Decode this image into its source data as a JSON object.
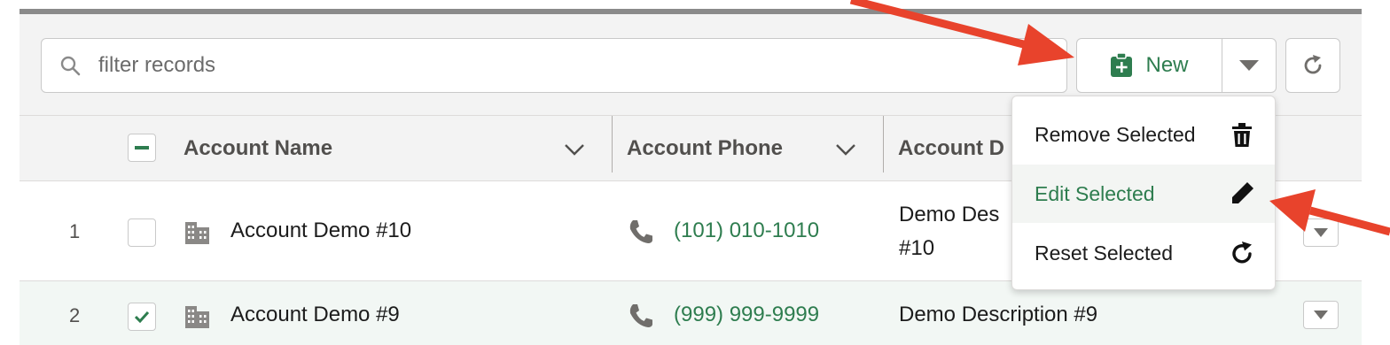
{
  "search": {
    "placeholder": "filter records",
    "value": ""
  },
  "toolbar": {
    "new_label": "New"
  },
  "columns": [
    {
      "label": "Account Name"
    },
    {
      "label": "Account Phone"
    },
    {
      "label": "Account D"
    }
  ],
  "rows": [
    {
      "num": "1",
      "checked": false,
      "name": "Account Demo #10",
      "phone": "(101) 010-1010",
      "description_line1": "Demo Des",
      "description_line2": "#10"
    },
    {
      "num": "2",
      "checked": true,
      "name": "Account Demo #9",
      "phone": "(999) 999-9999",
      "description_line1": "Demo Description #9",
      "description_line2": ""
    }
  ],
  "menu": {
    "items": [
      {
        "label": "Remove Selected",
        "icon": "trash-icon"
      },
      {
        "label": "Edit Selected",
        "icon": "pencil-icon",
        "active": true
      },
      {
        "label": "Reset Selected",
        "icon": "refresh-icon"
      }
    ]
  },
  "colors": {
    "accent": "#2e7d4f",
    "annotation_arrow": "#e8432c"
  }
}
